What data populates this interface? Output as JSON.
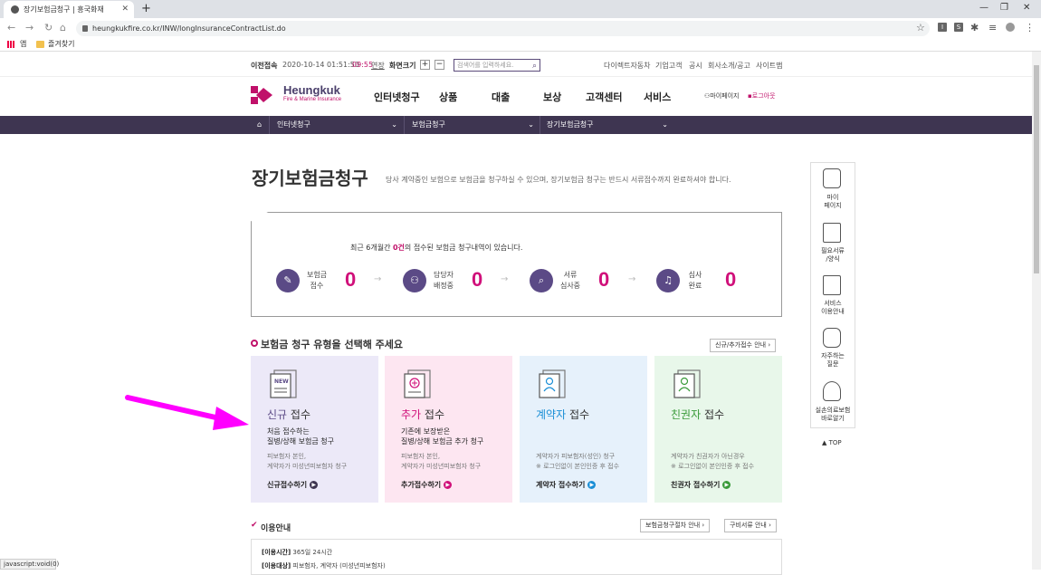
{
  "browser": {
    "tab_title": "장기보험금청구 | 흥국화재",
    "url": "heungkukfire.co.kr/INW/longInsuranceContractList.do",
    "bookmarks": [
      "앱",
      "즐겨찾기"
    ]
  },
  "topbar": {
    "last_login_label": "이전접속",
    "last_login_time": "2020-10-14 01:51:50",
    "session_time": "09:55",
    "extend": "연장",
    "zoom_label": "화면크기",
    "zoom_in": "+",
    "zoom_out": "−",
    "search_placeholder": "검색어를 입력하세요.",
    "links": [
      "다이렉트자동차",
      "기업고객",
      "공시",
      "회사소개/공고",
      "사이트맵"
    ]
  },
  "header": {
    "logo_title": "Heungkuk",
    "logo_sub": "Fire & Marine Insurance",
    "gnb": [
      "인터넷청구",
      "상품",
      "대출",
      "보상",
      "고객센터",
      "서비스"
    ],
    "mypage": "마이페이지",
    "logout": "로그아웃"
  },
  "subnav": {
    "items": [
      "인터넷청구",
      "보험금청구",
      "장기보험금청구"
    ]
  },
  "page": {
    "title": "장기보험금청구",
    "desc": "당사 계약중인 보험으로 보험금을 청구하실 수 있으며, 장기보험금 청구는 반드시 서류접수까지 완료하셔야 합니다."
  },
  "status": {
    "msg_pre": "최근 6개월간 ",
    "msg_count": "0건",
    "msg_post": "의 접수된 보험금 청구내역이 있습니다.",
    "steps": [
      {
        "label1": "보험금",
        "label2": "접수",
        "count": "0"
      },
      {
        "label1": "담당자",
        "label2": "배정중",
        "count": "0"
      },
      {
        "label1": "서류",
        "label2": "심사중",
        "count": "0"
      },
      {
        "label1": "심사",
        "label2": "완료",
        "count": "0"
      }
    ]
  },
  "section": {
    "title": "보험금 청구 유형을 선택해 주세요",
    "guide_button": "신규/추가접수 안내 ›"
  },
  "cards": [
    {
      "hl": "신규",
      "rest": " 접수",
      "d1a": "처음 접수하는",
      "d1b": "질병/상해 보험금 청구",
      "d2a": "피보험자 본인,",
      "d2b": "계약자가 미성년피보험자 청구",
      "go": "신규접수하기",
      "color": "#5b4a86",
      "bg": "#ece9f8"
    },
    {
      "hl": "추가",
      "rest": " 접수",
      "d1a": "기존에 보장받은",
      "d1b": "질병/상해 보험금 추가 청구",
      "d2a": "피보험자 본인,",
      "d2b": "계약자가 미성년피보험자 청구",
      "go": "추가접수하기",
      "color": "#d0107a",
      "bg": "#fde6f1"
    },
    {
      "hl": "계약자",
      "rest": " 접수",
      "d1a": "",
      "d1b": "",
      "d2a": "계약자가 피보험자(성인) 청구",
      "d2b": "※ 로그인없이 본인인증 후 접수",
      "go": "계약자 접수하기",
      "color": "#1b8fd6",
      "bg": "#e6f1fb"
    },
    {
      "hl": "친권자",
      "rest": " 접수",
      "d1a": "",
      "d1b": "",
      "d2a": "계약자가 친권자가 아닌경우",
      "d2b": "※ 로그인없이 본인인증 후 접수",
      "go": "친권자 접수하기",
      "color": "#3a9b3a",
      "bg": "#e8f7ea"
    }
  ],
  "guide": {
    "title": "이용안내",
    "btn1": "보험금청구절차 안내 ›",
    "btn2": "구비서류 안내 ›",
    "line1_label": "[이용시간]",
    "line1_val": "365일 24시간",
    "line2_label": "[이용대상]",
    "line2_val": "피보험자, 계약자 (미성년피보험자)"
  },
  "quick": {
    "items": [
      "마이\n페이지",
      "필요서류\n/양식",
      "서비스\n이용안내",
      "자주하는\n질문",
      "실손의료보험\n바로알기"
    ],
    "top": "▲ TOP"
  },
  "statusbar": "javascript:void(0)"
}
